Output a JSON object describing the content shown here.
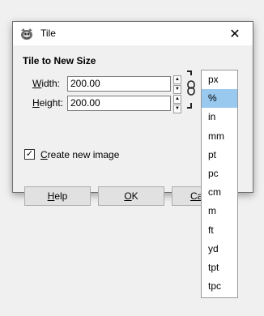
{
  "window": {
    "title": "Tile",
    "close_glyph": "✕"
  },
  "section": {
    "title": "Tile to New Size"
  },
  "width": {
    "label_prefix": "",
    "label_mnemonic": "W",
    "label_rest": "idth:",
    "value": "200.00"
  },
  "height": {
    "label_prefix": "",
    "label_mnemonic": "H",
    "label_rest": "eight:",
    "value": "200.00"
  },
  "spin": {
    "up": "▲",
    "down": "▼"
  },
  "create_image": {
    "checked": true,
    "check_glyph": "✓",
    "label_prefix": "",
    "label_mnemonic": "C",
    "label_rest": "reate new image"
  },
  "buttons": {
    "help": {
      "mnemonic": "H",
      "rest": "elp"
    },
    "ok": {
      "mnemonic": "O",
      "rest": "K"
    },
    "cancel_visible": {
      "mnemonic": "Ca",
      "rest": ""
    }
  },
  "unit_menu": {
    "selected": "%",
    "items": [
      "px",
      "%",
      "in",
      "mm",
      "pt",
      "pc",
      "cm",
      "m",
      "ft",
      "yd",
      "tpt",
      "tpc"
    ]
  }
}
